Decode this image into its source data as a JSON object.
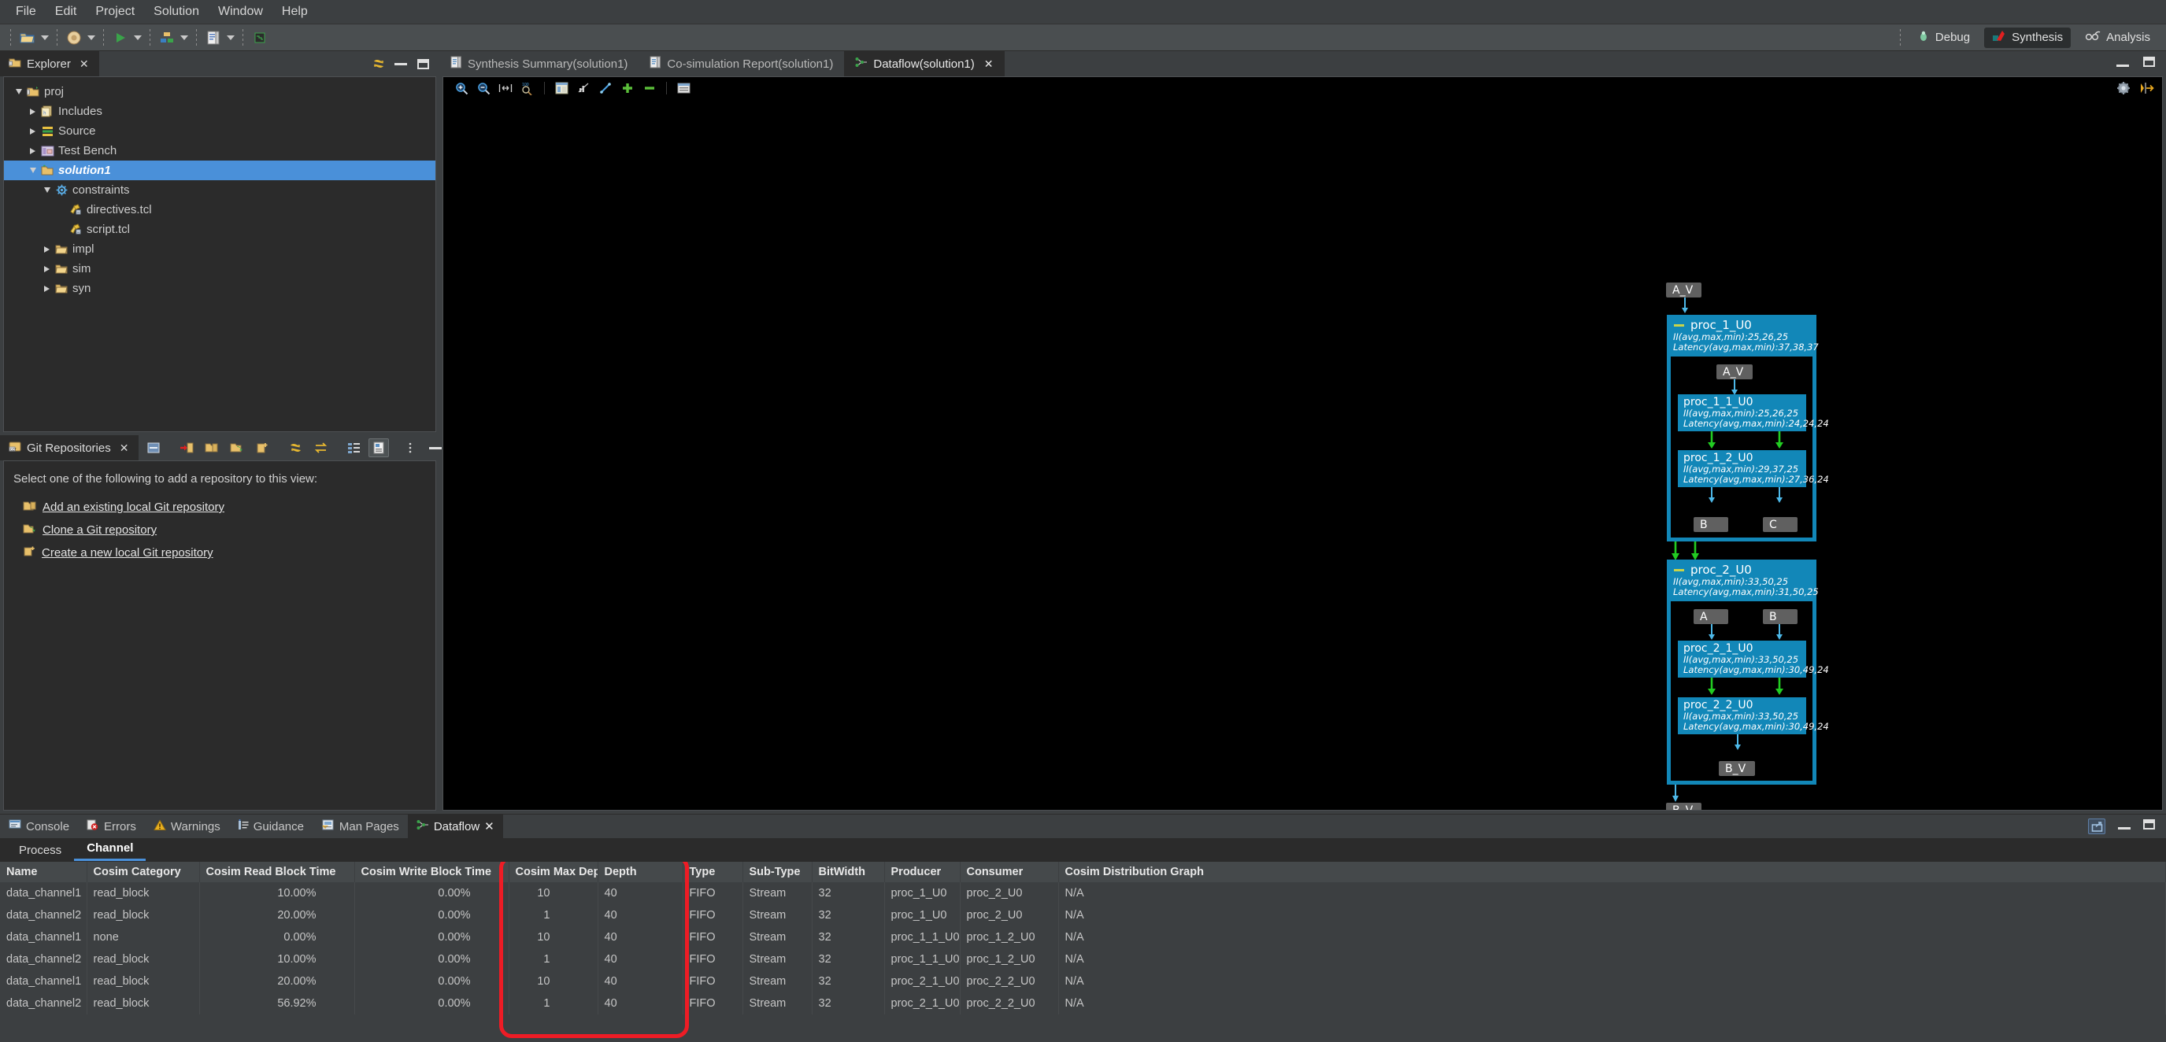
{
  "menubar": {
    "items": [
      "File",
      "Edit",
      "Project",
      "Solution",
      "Window",
      "Help"
    ]
  },
  "toolbar": {
    "icons": [
      "open-folder-icon",
      "build-gear-icon",
      "run-icon",
      "cosim-icon",
      "report-icon",
      "chip-icon"
    ],
    "perspectives": [
      {
        "label": "Debug",
        "icon": "bug-icon",
        "active": false
      },
      {
        "label": "Synthesis",
        "icon": "synthesis-icon",
        "active": true
      },
      {
        "label": "Analysis",
        "icon": "analysis-icon",
        "active": false
      }
    ]
  },
  "explorer": {
    "tab_label": "Explorer",
    "tab_icon": "explorer-icon",
    "close_label": "✕",
    "tools": [
      "link-with-editor-icon",
      "minimize-icon",
      "maximize-icon"
    ],
    "tree": [
      {
        "label": "proj",
        "indent": 0,
        "twisty": "down",
        "icon": "project-icon",
        "selected": false
      },
      {
        "label": "Includes",
        "indent": 1,
        "twisty": "right",
        "icon": "includes-icon",
        "selected": false
      },
      {
        "label": "Source",
        "indent": 1,
        "twisty": "right",
        "icon": "source-icon",
        "selected": false
      },
      {
        "label": "Test Bench",
        "indent": 1,
        "twisty": "right",
        "icon": "testbench-icon",
        "selected": false
      },
      {
        "label": "solution1",
        "indent": 1,
        "twisty": "down",
        "icon": "solution-icon",
        "selected": true
      },
      {
        "label": "constraints",
        "indent": 2,
        "twisty": "down",
        "icon": "constraints-icon",
        "selected": false
      },
      {
        "label": "directives.tcl",
        "indent": 3,
        "twisty": "none",
        "icon": "tcl-file-icon",
        "selected": false
      },
      {
        "label": "script.tcl",
        "indent": 3,
        "twisty": "none",
        "icon": "tcl-file-icon",
        "selected": false
      },
      {
        "label": "impl",
        "indent": 2,
        "twisty": "right",
        "icon": "folder-icon",
        "selected": false
      },
      {
        "label": "sim",
        "indent": 2,
        "twisty": "right",
        "icon": "folder-icon",
        "selected": false
      },
      {
        "label": "syn",
        "indent": 2,
        "twisty": "right",
        "icon": "folder-icon",
        "selected": false
      }
    ]
  },
  "git": {
    "tab_label": "Git Repositories",
    "tab_icon": "git-icon",
    "close_label": "✕",
    "toolbar_icons": [
      "collapse-all-icon",
      "add-repo-icon",
      "existing-repo-icon",
      "clone-repo-icon",
      "create-repo-icon",
      "refresh-icon",
      "switch-icon",
      "tree-compare-icon",
      "link-selection-icon",
      "view-menu-icon",
      "minimize-icon",
      "maximize-icon"
    ],
    "intro": "Select one of the following to add a repository to this view:",
    "links": [
      {
        "label": "Add an existing local Git repository",
        "icon": "existing-repo-icon"
      },
      {
        "label": "Clone a Git repository",
        "icon": "clone-repo-icon"
      },
      {
        "label": "Create a new local Git repository",
        "icon": "create-repo-icon"
      }
    ]
  },
  "editor": {
    "tabs": [
      {
        "label": "Synthesis Summary(solution1)",
        "icon": "report-icon",
        "active": false,
        "closable": false
      },
      {
        "label": "Co-simulation Report(solution1)",
        "icon": "report-icon",
        "active": false,
        "closable": false
      },
      {
        "label": "Dataflow(solution1)",
        "icon": "dataflow-icon",
        "active": true,
        "closable": true
      }
    ],
    "close_label": "✕",
    "canvas_toolbar": [
      "zoom-in-icon",
      "zoom-out-icon",
      "fit-width-icon",
      "zoom-100-icon",
      "layout-icon",
      "chart-icon",
      "path-icon",
      "expand-all-icon",
      "collapse-all-icon",
      "list-icon"
    ],
    "canvas_toolbar_right": [
      "settings-icon",
      "toggle-panel-icon"
    ]
  },
  "graph": {
    "nodes": {
      "top_port": {
        "label": "A_V"
      },
      "bottom_port": {
        "label": "B_V"
      },
      "proc_1_U0": {
        "title": "proc_1_U0",
        "ii": "II(avg,max,min):25,26,25",
        "latency": "Latency(avg,max,min):37,38,37",
        "inner_port": "A_V",
        "children": [
          {
            "title": "proc_1_1_U0",
            "ii": "II(avg,max,min):25,26,25",
            "latency": "Latency(avg,max,min):24,24,24"
          },
          {
            "title": "proc_1_2_U0",
            "ii": "II(avg,max,min):29,37,25",
            "latency": "Latency(avg,max,min):27,36,24"
          }
        ],
        "out_ports": [
          "B",
          "C"
        ]
      },
      "proc_2_U0": {
        "title": "proc_2_U0",
        "ii": "II(avg,max,min):33,50,25",
        "latency": "Latency(avg,max,min):31,50,25",
        "in_ports": [
          "A",
          "B"
        ],
        "children": [
          {
            "title": "proc_2_1_U0",
            "ii": "II(avg,max,min):33,50,25",
            "latency": "Latency(avg,max,min):30,49,24"
          },
          {
            "title": "proc_2_2_U0",
            "ii": "II(avg,max,min):33,50,25",
            "latency": "Latency(avg,max,min):30,49,24"
          }
        ],
        "out_port": "B_V"
      }
    },
    "colors": {
      "block": "#1287b8",
      "port": "#606060",
      "edge_blue": "#4db8e8",
      "edge_green": "#22cc22"
    }
  },
  "bottom": {
    "tabs": [
      {
        "label": "Console",
        "icon": "console-icon",
        "active": false,
        "closable": false
      },
      {
        "label": "Errors",
        "icon": "errors-icon",
        "active": false,
        "closable": false
      },
      {
        "label": "Warnings",
        "icon": "warnings-icon",
        "active": false,
        "closable": false
      },
      {
        "label": "Guidance",
        "icon": "guidance-icon",
        "active": false,
        "closable": false
      },
      {
        "label": "Man Pages",
        "icon": "manpages-icon",
        "active": false,
        "closable": false
      },
      {
        "label": "Dataflow",
        "icon": "dataflow-icon",
        "active": true,
        "closable": true
      }
    ],
    "close_label": "✕",
    "controls": [
      "restore-icon",
      "minimize-icon",
      "maximize-icon"
    ],
    "subtabs": [
      {
        "label": "Process",
        "active": false
      },
      {
        "label": "Channel",
        "active": true
      }
    ],
    "table": {
      "columns": [
        "Name",
        "Cosim Category",
        "Cosim Read Block Time",
        "Cosim Write Block Time",
        "Cosim Max Depth",
        "Depth",
        "Type",
        "Sub-Type",
        "BitWidth",
        "Producer",
        "Consumer",
        "Cosim Distribution Graph"
      ],
      "rows": [
        [
          "data_channel1",
          "read_block",
          "10.00%",
          "0.00%",
          "10",
          "40",
          "FIFO",
          "Stream",
          "32",
          "proc_1_U0",
          "proc_2_U0",
          "N/A"
        ],
        [
          "data_channel2",
          "read_block",
          "20.00%",
          "0.00%",
          "1",
          "40",
          "FIFO",
          "Stream",
          "32",
          "proc_1_U0",
          "proc_2_U0",
          "N/A"
        ],
        [
          "data_channel1",
          "none",
          "0.00%",
          "0.00%",
          "10",
          "40",
          "FIFO",
          "Stream",
          "32",
          "proc_1_1_U0",
          "proc_1_2_U0",
          "N/A"
        ],
        [
          "data_channel2",
          "read_block",
          "10.00%",
          "0.00%",
          "1",
          "40",
          "FIFO",
          "Stream",
          "32",
          "proc_1_1_U0",
          "proc_1_2_U0",
          "N/A"
        ],
        [
          "data_channel1",
          "read_block",
          "20.00%",
          "0.00%",
          "10",
          "40",
          "FIFO",
          "Stream",
          "32",
          "proc_2_1_U0",
          "proc_2_2_U0",
          "N/A"
        ],
        [
          "data_channel2",
          "read_block",
          "56.92%",
          "0.00%",
          "1",
          "40",
          "FIFO",
          "Stream",
          "32",
          "proc_2_1_U0",
          "proc_2_2_U0",
          "N/A"
        ]
      ]
    },
    "highlight": {
      "color": "#ee1c25",
      "columns": [
        "Cosim Max Depth",
        "Depth"
      ]
    }
  }
}
